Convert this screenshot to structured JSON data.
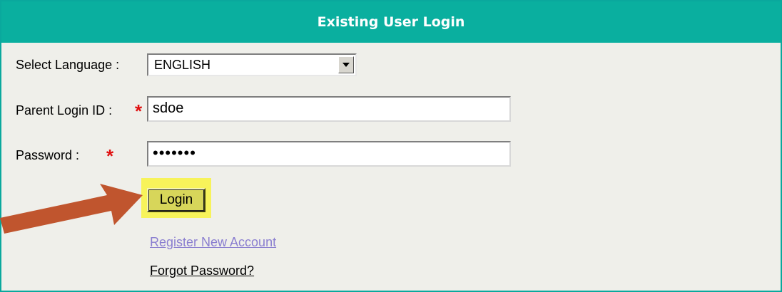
{
  "panel": {
    "title": "Existing User Login"
  },
  "form": {
    "language_label": "Select Language :",
    "language_value": "ENGLISH",
    "login_id_label": "Parent Login ID :",
    "login_id_value": "sdoe",
    "password_label": "Password :",
    "password_value": "•••••••",
    "required_marker": "*",
    "login_button": "Login"
  },
  "links": {
    "register": "Register New Account",
    "forgot": "Forgot Password?"
  },
  "colors": {
    "header": "#0aaf9f",
    "required": "#e01010",
    "highlight": "#f7f35a",
    "arrow": "#c0552e",
    "register_link": "#8a7ed0"
  },
  "icons": {
    "select_arrow": "chevron-down-icon",
    "annotation": "pointer-arrow-icon"
  }
}
